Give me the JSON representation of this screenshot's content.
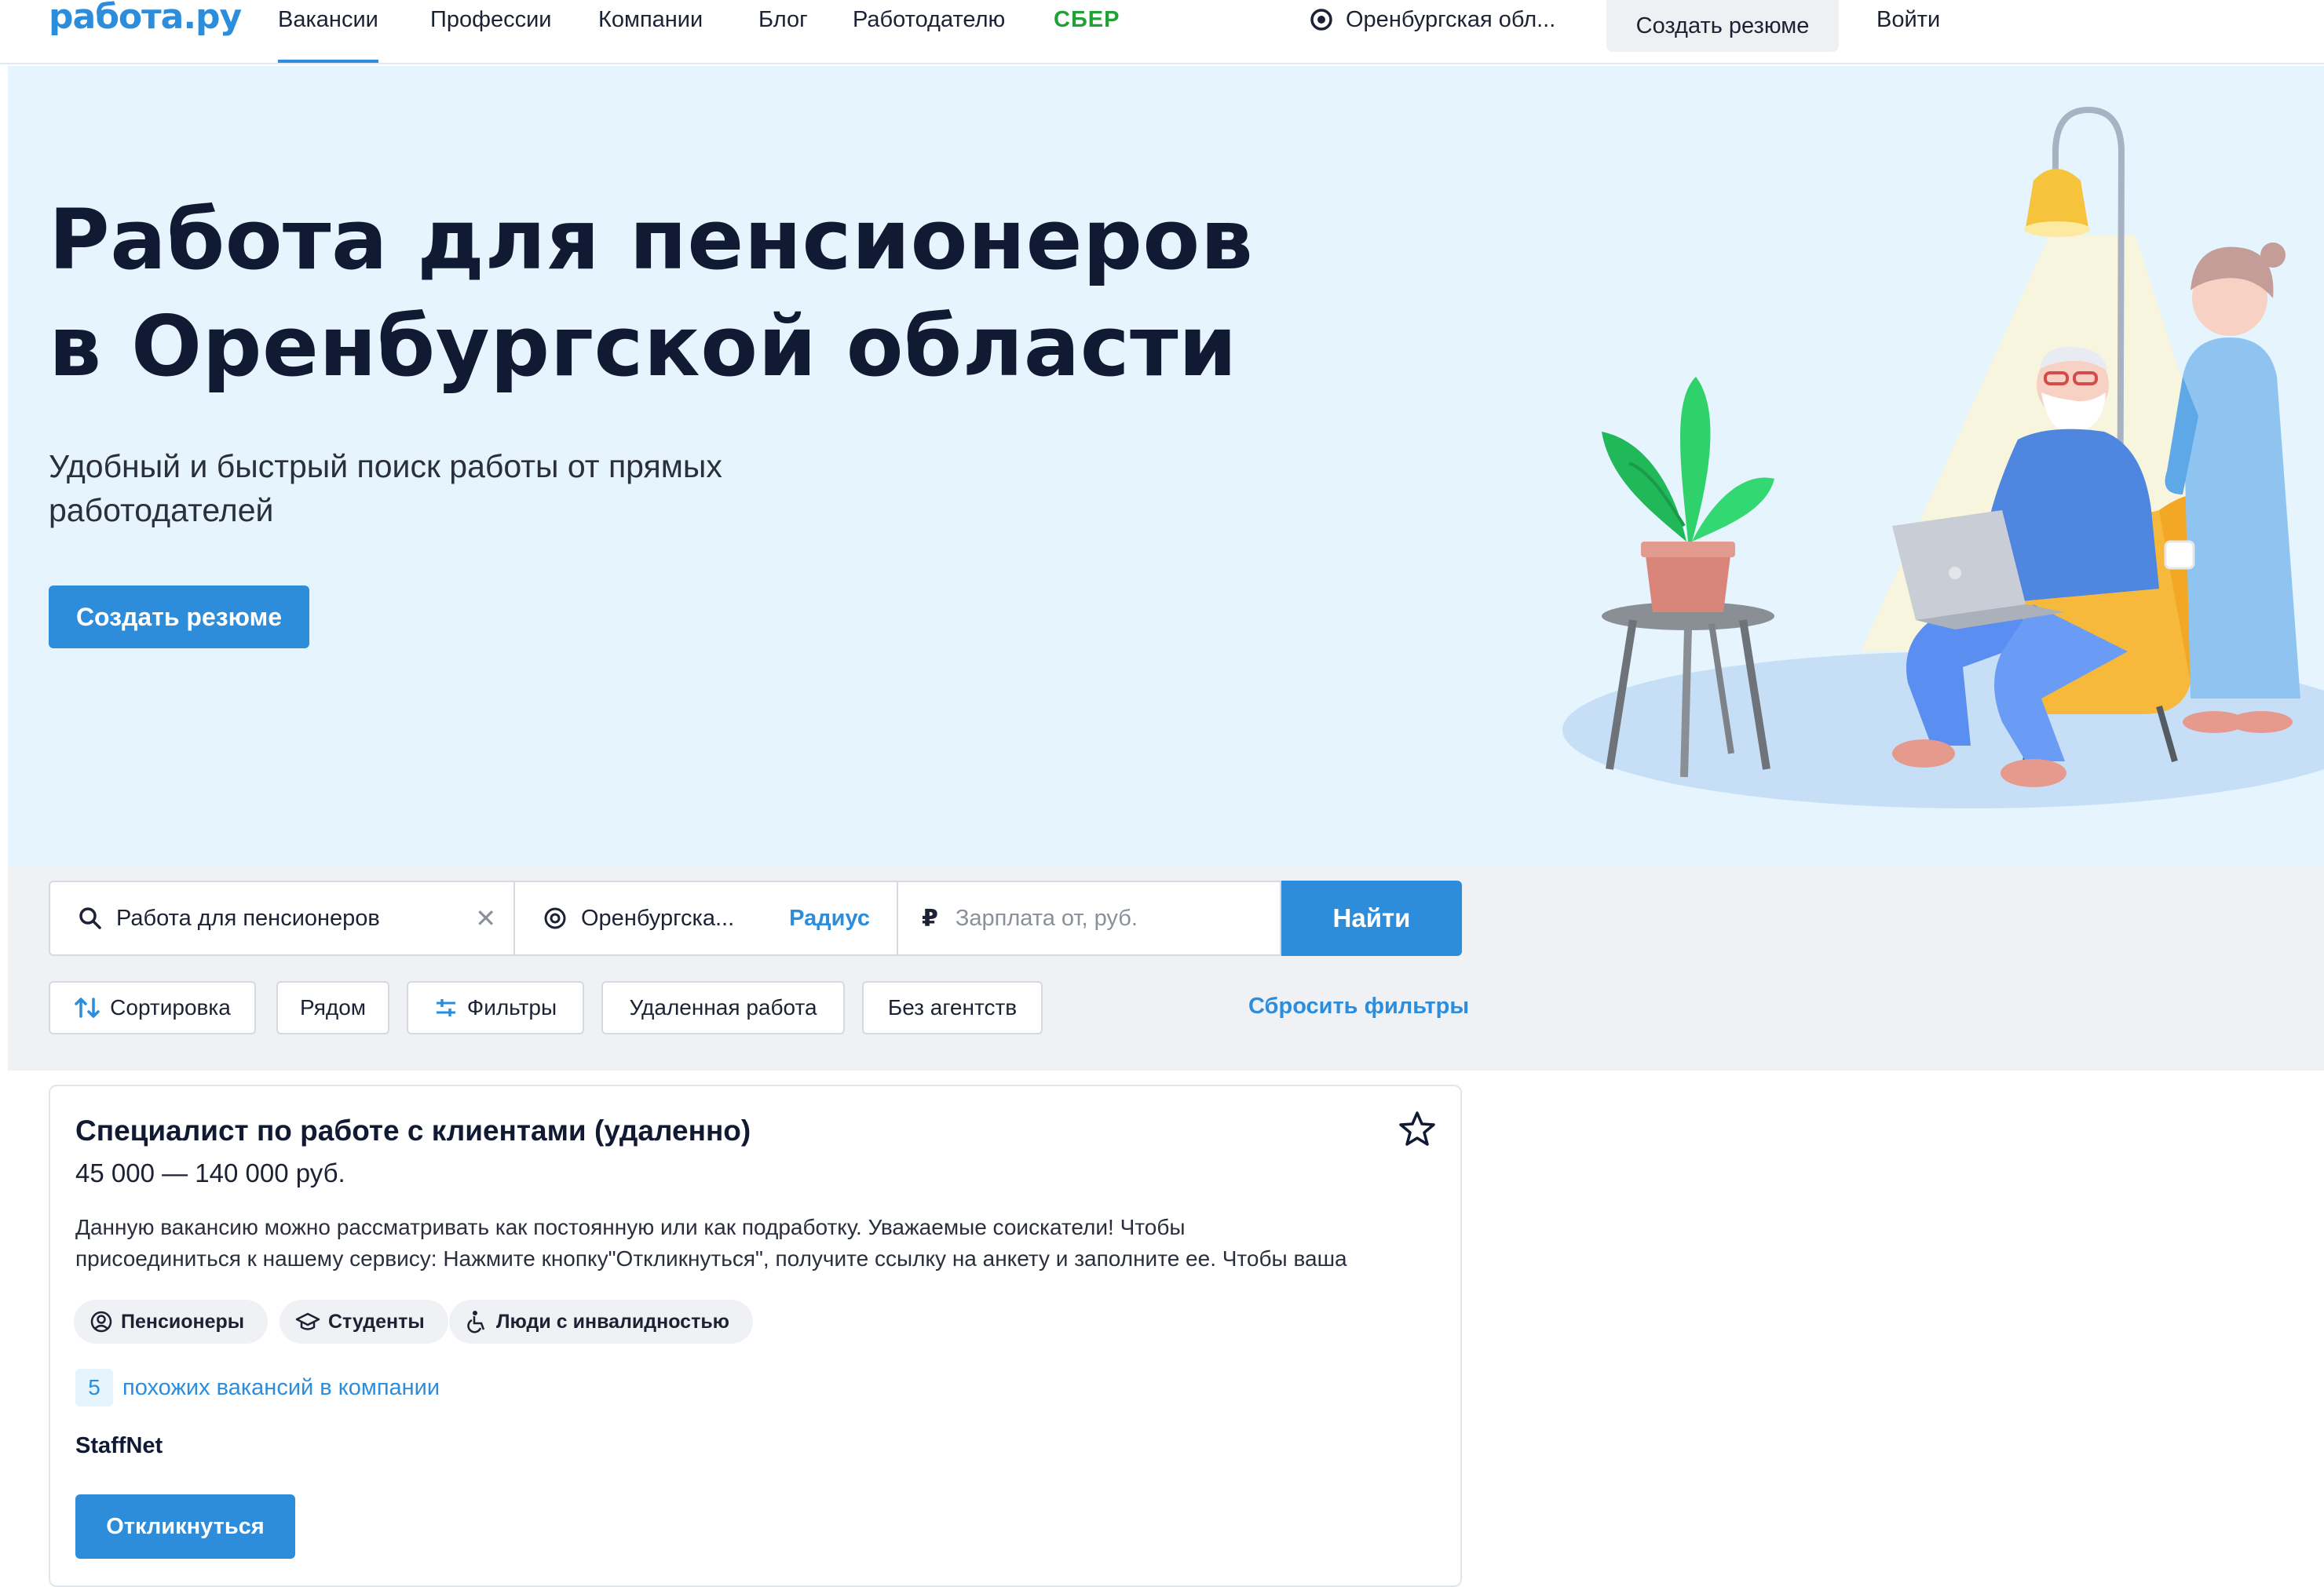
{
  "header": {
    "logo": "работа.ру",
    "nav": [
      "Вакансии",
      "Профессии",
      "Компании",
      "Блог",
      "Работодателю",
      "СБЕР"
    ],
    "region": "Оренбургская обл...",
    "create_resume": "Создать резюме",
    "login": "Войти"
  },
  "hero": {
    "title_line1": "Работа для пенсионеров",
    "title_line2": "в Оренбургской области",
    "subtitle": "Удобный и быстрый поиск работы от прямых работодателей",
    "cta": "Создать резюме"
  },
  "search": {
    "query": "Работа для пенсионеров",
    "location": "Оренбургска...",
    "radius": "Радиус",
    "salary_placeholder": "Зарплата от, руб.",
    "find": "Найти"
  },
  "filters": {
    "sort": "Сортировка",
    "nearby": "Рядом",
    "filters": "Фильтры",
    "remote": "Удаленная работа",
    "no_agencies": "Без агентств",
    "reset": "Сбросить фильтры"
  },
  "vacancy": {
    "title": "Специалист по работе с клиентами (удаленно)",
    "salary": "45 000 — 140 000 руб.",
    "description_line1": "Данную вакансию можно рассматривать как постоянную или как подработку. Уважаемые соискатели! Чтобы",
    "description_line2": "присоединиться к нашему сервису: Нажмите кнопку\"Откликнуться\", получите ссылку на анкету и заполните ее. Чтобы ваша",
    "tags": [
      "Пенсионеры",
      "Студенты",
      "Люди с инвалидностью"
    ],
    "similar_count": "5",
    "similar_text": "похожих вакансий в компании",
    "company": "StaffNet",
    "apply": "Откликнуться"
  },
  "colors": {
    "brand_blue": "#2e8ddb",
    "sber_green": "#21a038",
    "hero_bg": "#e5f4fd"
  }
}
